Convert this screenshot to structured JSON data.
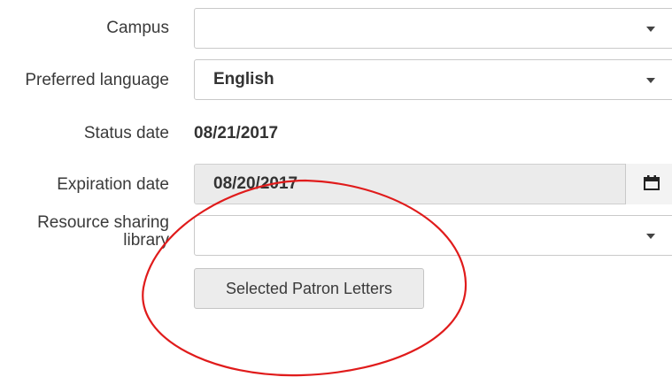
{
  "form": {
    "campus": {
      "label": "Campus",
      "value": ""
    },
    "preferred_language": {
      "label": "Preferred language",
      "value": "English"
    },
    "status_date": {
      "label": "Status date",
      "value": "08/21/2017"
    },
    "expiration_date": {
      "label": "Expiration date",
      "value": "08/20/2017"
    },
    "resource_sharing_library": {
      "label": "Resource sharing library",
      "value": ""
    },
    "selected_patron_letters_button": "Selected Patron Letters"
  },
  "icons": {
    "dropdown": "chevron-down-icon",
    "calendar": "calendar-icon"
  },
  "colors": {
    "annotation": "#e01b1b",
    "disabled_field": "#ebebeb",
    "button_bg": "#ececec"
  }
}
